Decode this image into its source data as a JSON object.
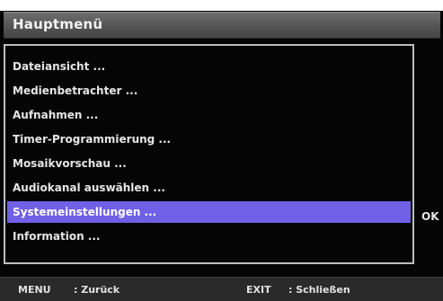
{
  "header": {
    "title": "Hauptmenü"
  },
  "menu": {
    "items": [
      {
        "label": "Dateiansicht ..."
      },
      {
        "label": "Medienbetrachter ..."
      },
      {
        "label": "Aufnahmen ..."
      },
      {
        "label": "Timer-Programmierung ..."
      },
      {
        "label": "Mosaikvorschau ..."
      },
      {
        "label": "Audiokanal auswählen ..."
      },
      {
        "label": "Systemeinstellungen ...",
        "selected": true
      },
      {
        "label": "Information ..."
      }
    ],
    "selected_index": 6,
    "ok_label": "OK"
  },
  "footer": {
    "menu_key": "MENU",
    "menu_action": ": Zurück",
    "exit_key": "EXIT",
    "exit_action": ": Schließen"
  },
  "colors": {
    "background": "#050505",
    "title_bar": "#565656",
    "selection": "#6f60e6",
    "text": "#e6e6e6",
    "footer": "#2a2a2a"
  }
}
